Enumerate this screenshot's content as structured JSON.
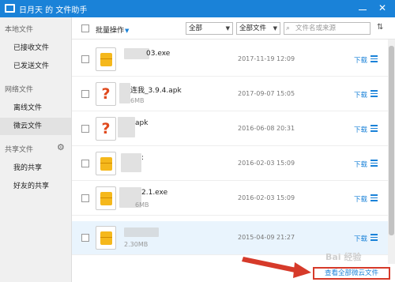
{
  "window": {
    "title": "日月天 的 文件助手",
    "minimize_icon": "minimize-icon",
    "close_label": "✕"
  },
  "sidebar": {
    "local_head": "本地文件",
    "received": "已接收文件",
    "sent": "已发送文件",
    "network_head": "网络文件",
    "offline": "离线文件",
    "weiyun": "微云文件",
    "shared_head": "共享文件",
    "my_share": "我的共享",
    "friend_share": "好友的共享"
  },
  "toolbar": {
    "batch_label": "批量操作",
    "filter1": "全部",
    "filter2": "全部文件",
    "search_placeholder": "文件名或来源"
  },
  "files": [
    {
      "name": "03.exe",
      "size": "",
      "date": "2017-11-19 12:09",
      "download": "下载",
      "icon": "exe"
    },
    {
      "name": "连我_3.9.4.apk",
      "size": "6MB",
      "date": "2017-09-07 15:05",
      "download": "下载",
      "icon": "unknown"
    },
    {
      "name": "apk",
      "size": "",
      "date": "2016-06-08 20:31",
      "download": "下载",
      "icon": "unknown"
    },
    {
      "name": ":",
      "size": "",
      "date": "2016-02-03 15:09",
      "download": "下载",
      "icon": "exe"
    },
    {
      "name": "2.1.exe",
      "size": "6MB",
      "date": "2016-02-03 15:09",
      "download": "下载",
      "icon": "exe"
    },
    {
      "name": "",
      "size": "2.30MB",
      "date": "2015-04-09 21:27",
      "download": "下载",
      "icon": "exe"
    }
  ],
  "footer": {
    "view_all": "查看全部微云文件"
  },
  "watermark": "Bai 经验",
  "colors": {
    "accent": "#1a82d8",
    "highlight": "#d63a2a"
  }
}
